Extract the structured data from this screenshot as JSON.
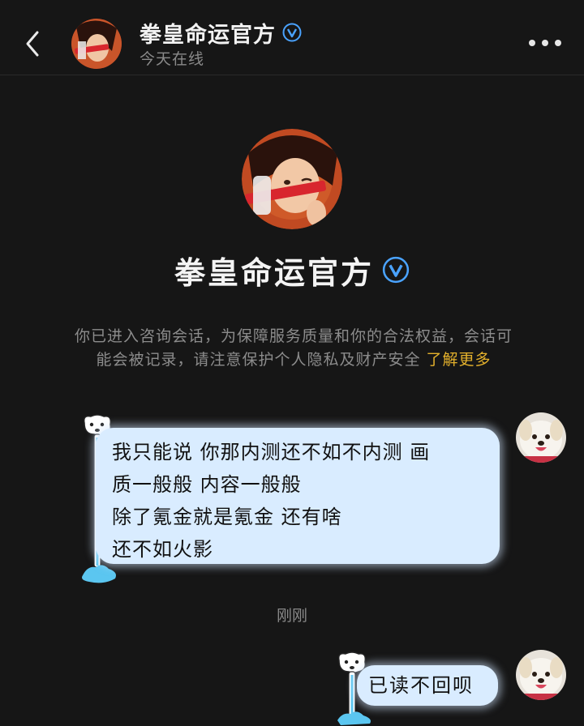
{
  "header": {
    "title": "拳皇命运官方",
    "status": "今天在线"
  },
  "profile": {
    "name": "拳皇命运官方"
  },
  "notice": {
    "text": "你已进入咨询会话，为保障服务质量和你的合法权益，会话可能会被记录，请注意保护个人隐私及财产安全",
    "link": "了解更多"
  },
  "messages": [
    {
      "lines": [
        "我只能说 你那内测还不如不内测  画",
        "质一般般  内容一般般",
        "除了氪金就是氪金  还有啥",
        "还不如火影"
      ]
    },
    {
      "text": "已读不回呗"
    }
  ],
  "timestamp": "刚刚",
  "icons": {
    "back": "chevron-left-icon",
    "more": "more-dots-icon",
    "verified": "verified-v-icon"
  },
  "colors": {
    "background": "#161616",
    "bubble": "#d9ecff",
    "verified": "#4aa3ff",
    "link": "#e4b12c"
  }
}
